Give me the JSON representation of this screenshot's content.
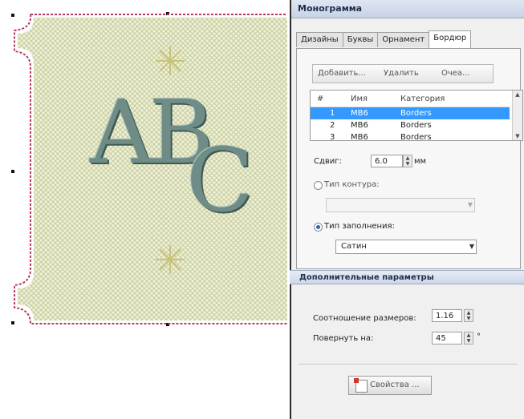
{
  "panel": {
    "title": "Монограмма",
    "tabs": [
      "Дизайны",
      "Буквы",
      "Орнамент",
      "Бордюр"
    ],
    "active_tab": "Бордюр"
  },
  "toolbar": {
    "add_label": "Добавить...",
    "delete_label": "Удалить",
    "clear_label": "Очеa..."
  },
  "grid": {
    "columns": [
      "#",
      "Имя",
      "Категория"
    ],
    "rows": [
      {
        "num": "1",
        "name": "MB6",
        "category": "Borders",
        "selected": true
      },
      {
        "num": "2",
        "name": "MB6",
        "category": "Borders",
        "selected": false
      },
      {
        "num": "3",
        "name": "MB6",
        "category": "Borders",
        "selected": false
      }
    ]
  },
  "offset": {
    "label": "Сдвиг:",
    "value": "6.0",
    "unit": "мм"
  },
  "outline": {
    "label": "Тип контура:",
    "value": ""
  },
  "fill": {
    "label": "Тип заполнения:",
    "value": "Сатин"
  },
  "advanced": {
    "title": "Дополнительные параметры",
    "ratio_label": "Соотношение размеров:",
    "ratio_value": "1.16",
    "rotate_label": "Повернуть на:",
    "rotate_value": "45",
    "rotate_unit": "°"
  },
  "properties_label": "Свойства ...",
  "canvas": {
    "monogram_text_1": "AB",
    "monogram_text_2": "C"
  },
  "colors": {
    "border": "#b03a63",
    "fabric": "#e4e8c9",
    "letters": "#6f8c86",
    "selection": "#3399ff"
  }
}
